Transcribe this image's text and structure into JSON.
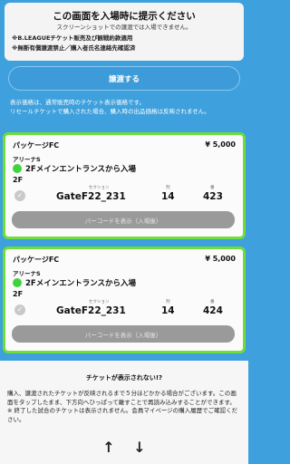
{
  "notice": {
    "title": "この画面を入場時に提示ください",
    "subtitle": "スクリーンショットでの譲渡では入場できません。",
    "line1": "※B.LEAGUEチケット販売及び観戦約款適用",
    "line2": "※無断有償譲渡禁止／購入者氏名連絡先確認済"
  },
  "transfer_button": "譲渡する",
  "info": {
    "line1": "表示価格は、通常販売時のチケット表示価格です。",
    "line2": "リセールチケットで購入された場合、購入時の出品価格は反映されません。"
  },
  "tickets": [
    {
      "package": "パッケージFC",
      "price": "¥ 5,000",
      "seat_type": "アリーナS",
      "entrance": "2Fメインエントランスから入場",
      "floor": "2F",
      "section_header": "セクション",
      "row_header": "列",
      "number_header": "番",
      "section": "GateF22_231",
      "row": "14",
      "number": "423",
      "barcode_label": "バーコードを表示（入場後）"
    },
    {
      "package": "パッケージFC",
      "price": "¥ 5,000",
      "seat_type": "アリーナS",
      "entrance": "2Fメインエントランスから入場",
      "floor": "2F",
      "section_header": "セクション",
      "row_header": "列",
      "number_header": "番",
      "section": "GateF22_231",
      "row": "14",
      "number": "424",
      "barcode_label": "バーコードを表示（入場後）"
    }
  ],
  "help": {
    "question": "チケットが表示されない!?",
    "para1": "購入、譲渡されたチケットが反映されるまで５分ほどかかる場合がございます。この画面をタップしたまま、下方向へひっぱって離すことで再読み込みすることができます。",
    "para2": "※ 終了した試合のチケットは表示されません。会員マイページの購入履歴でご確認ください。"
  },
  "icons": {
    "check": "check-circle-icon",
    "entrance_dot": "green-dot-icon",
    "arrow_up": "arrow-up-icon",
    "arrow_down": "arrow-down-icon"
  },
  "colors": {
    "background": "#3ea0dc",
    "ticket_border": "#6fdd3a",
    "entrance_dot": "#3ed43e",
    "barcode_button": "#9a9a9a"
  }
}
